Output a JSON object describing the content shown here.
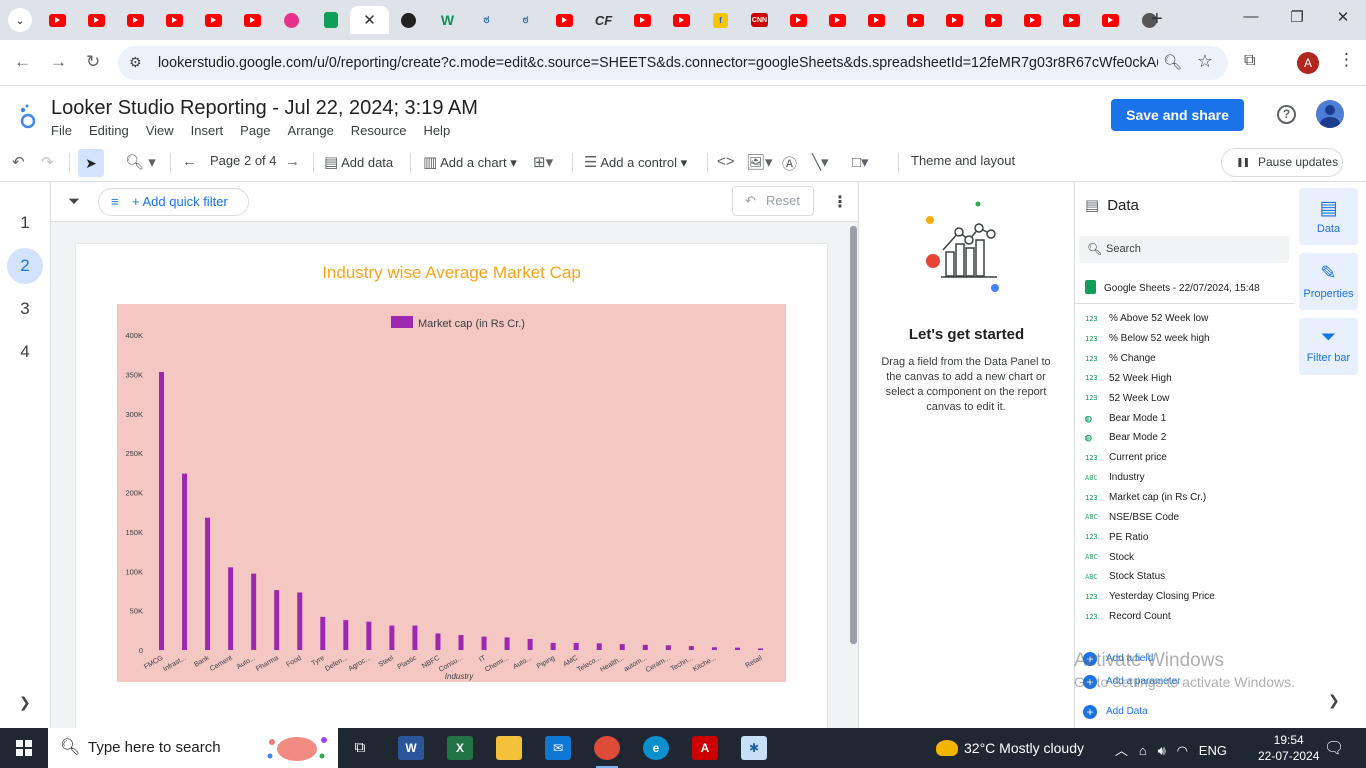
{
  "browser": {
    "tabs": [
      {
        "icon": "youtube-icon",
        "type": "yt"
      },
      {
        "icon": "youtube-icon",
        "type": "yt"
      },
      {
        "icon": "youtube-icon",
        "type": "yt"
      },
      {
        "icon": "youtube-icon",
        "type": "yt"
      },
      {
        "icon": "youtube-icon",
        "type": "yt"
      },
      {
        "icon": "youtube-icon",
        "type": "yt"
      },
      {
        "icon": "instagram-icon",
        "type": "pink"
      },
      {
        "icon": "google-sheets-icon",
        "type": "sheets"
      },
      {
        "icon": "close-icon",
        "type": "active"
      },
      {
        "icon": "threads-icon",
        "type": "threads"
      },
      {
        "icon": "w-icon",
        "type": "w",
        "glyph": "W"
      },
      {
        "icon": "org-icon",
        "type": "org",
        "glyph": "ಠ"
      },
      {
        "icon": "org-icon",
        "type": "org",
        "glyph": "ಠ"
      },
      {
        "icon": "youtube-icon",
        "type": "yt"
      },
      {
        "icon": "cf-icon",
        "type": "cf",
        "glyph": "CF"
      },
      {
        "icon": "youtube-icon",
        "type": "yt"
      },
      {
        "icon": "youtube-icon",
        "type": "yt"
      },
      {
        "icon": "flipkart-icon",
        "type": "flip",
        "glyph": "f"
      },
      {
        "icon": "cnn-icon",
        "type": "cnn",
        "glyph": "CNN"
      },
      {
        "icon": "youtube-icon",
        "type": "yt"
      },
      {
        "icon": "youtube-icon",
        "type": "yt"
      },
      {
        "icon": "youtube-icon",
        "type": "yt"
      },
      {
        "icon": "youtube-icon",
        "type": "yt"
      },
      {
        "icon": "youtube-icon",
        "type": "yt"
      },
      {
        "icon": "youtube-icon",
        "type": "yt"
      },
      {
        "icon": "youtube-icon",
        "type": "yt"
      },
      {
        "icon": "youtube-icon",
        "type": "yt"
      },
      {
        "icon": "youtube-icon",
        "type": "yt"
      },
      {
        "icon": "github-icon",
        "type": "github"
      }
    ],
    "url": "lookerstudio.google.com/u/0/reporting/create?c.mode=edit&c.source=SHEETS&ds.connector=googleSheets&ds.spreadsheetId=12feMR7g03r8R67cWfe0ckA6...",
    "profile_initial": "A"
  },
  "app": {
    "title": "Looker Studio Reporting - Jul 22, 2024; 3:19 AM",
    "menu": [
      "File",
      "Editing",
      "View",
      "Insert",
      "Page",
      "Arrange",
      "Resource",
      "Help"
    ],
    "save_share": "Save and share"
  },
  "toolbar": {
    "page_indicator": "Page 2 of 4",
    "add_data": "Add data",
    "add_chart": "Add a chart",
    "add_control": "Add a control",
    "theme_layout": "Theme and layout",
    "pause_updates": "Pause updates"
  },
  "pages": {
    "numbers": [
      "1",
      "2",
      "3",
      "4"
    ],
    "active_index": 1
  },
  "canvas": {
    "quick_filter": "+ Add quick filter",
    "reset": "Reset",
    "chart_title": "Industry wise Average Market Cap"
  },
  "chart_data": {
    "type": "bar",
    "title": "Industry wise Average Market Cap",
    "xlabel": "Industry",
    "ylabel": "",
    "legend": "top-center",
    "series": [
      {
        "name": "Market cap (in Rs Cr.)",
        "color": "#9c27b0"
      }
    ],
    "categories": [
      "FMCG",
      "Infrast...",
      "Bank",
      "Cement",
      "Auto...",
      "Pharma",
      "Food",
      "Tyre",
      "Defen...",
      "Agroc...",
      "Steel",
      "Plastic",
      "NBFC",
      "Consu...",
      "IT",
      "Chemi...",
      "Auto...",
      "Piping",
      "AMC",
      "Teleco...",
      "Health...",
      "autom...",
      "Ceram...",
      "Techn...",
      "Kitche...",
      "",
      "Retail"
    ],
    "values": [
      353000,
      224000,
      168000,
      105000,
      97000,
      76000,
      73000,
      42000,
      38000,
      36000,
      31000,
      31000,
      21000,
      19000,
      17000,
      16000,
      14000,
      9000,
      9000,
      8500,
      7500,
      6500,
      6000,
      5000,
      3500,
      3000,
      2000
    ],
    "ylim": [
      0,
      400000
    ],
    "yticks": [
      "0",
      "50K",
      "100K",
      "150K",
      "200K",
      "250K",
      "300K",
      "350K",
      "400K"
    ],
    "background": "#f4c7c3",
    "title_color": "#f9a31c"
  },
  "start_panel": {
    "title": "Let's get started",
    "description": "Drag a field from the Data Panel to the canvas to add a new chart or select a component on the report canvas to edit it."
  },
  "data_panel": {
    "header": "Data",
    "search_placeholder": "Search",
    "source": "Google Sheets - 22/07/2024, 15:48",
    "fields": [
      {
        "type": "123",
        "name": "% Above 52 Week low"
      },
      {
        "type": "123",
        "name": "% Below 52 week high"
      },
      {
        "type": "123",
        "name": "% Change"
      },
      {
        "type": "123",
        "name": "52 Week High"
      },
      {
        "type": "123",
        "name": "52 Week Low"
      },
      {
        "type": "geo",
        "name": "Bear Mode 1"
      },
      {
        "type": "geo",
        "name": "Bear Mode 2"
      },
      {
        "type": "123",
        "name": "Current price"
      },
      {
        "type": "ABC",
        "name": "Industry"
      },
      {
        "type": "123",
        "name": "Market cap (in Rs Cr.)"
      },
      {
        "type": "ABC",
        "name": "NSE/BSE Code"
      },
      {
        "type": "123",
        "name": "PE Ratio"
      },
      {
        "type": "ABC",
        "name": "Stock"
      },
      {
        "type": "ABC",
        "name": "Stock Status"
      },
      {
        "type": "123",
        "name": "Yesterday Closing Price"
      },
      {
        "type": "123",
        "name": "Record Count"
      }
    ],
    "add_field": "Add a field",
    "add_parameter": "Add a parameter",
    "add_data": "Add Data"
  },
  "right_rail": {
    "data": "Data",
    "properties": "Properties",
    "filter_bar": "Filter bar"
  },
  "watermark": {
    "line1": "Activate Windows",
    "line2": "Go to Settings to activate Windows."
  },
  "taskbar": {
    "search_placeholder": "Type here to search",
    "weather": "32°C  Mostly cloudy",
    "weather_badge": "1",
    "language": "ENG",
    "time": "19:54",
    "date": "22-07-2024"
  }
}
